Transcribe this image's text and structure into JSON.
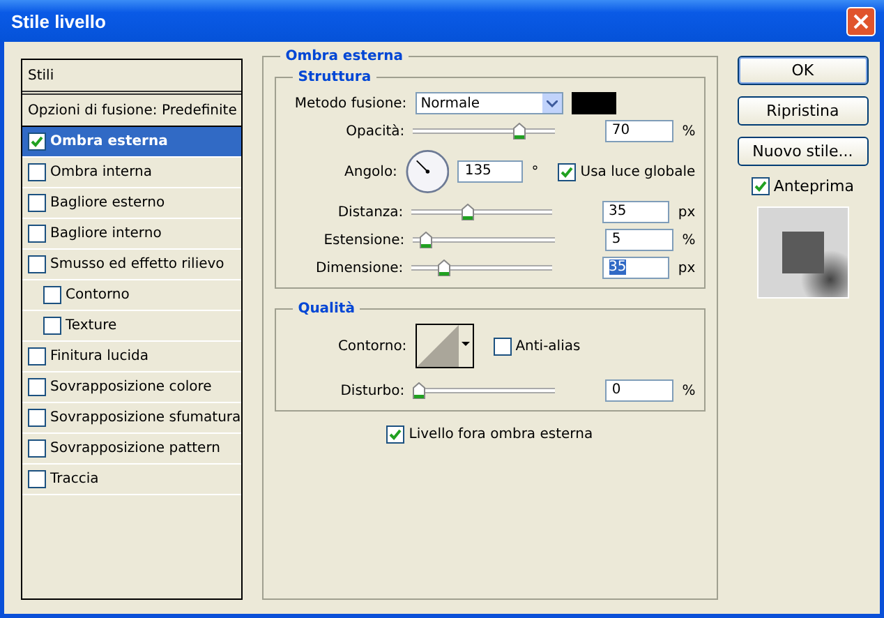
{
  "window": {
    "title": "Stile livello"
  },
  "styles_list": {
    "header": "Stili",
    "blend_options": "Opzioni di fusione: Predefinite",
    "items": [
      {
        "label": "Ombra esterna",
        "checked": true,
        "selected": true
      },
      {
        "label": "Ombra interna",
        "checked": false,
        "selected": false
      },
      {
        "label": "Bagliore esterno",
        "checked": false,
        "selected": false
      },
      {
        "label": "Bagliore interno",
        "checked": false,
        "selected": false
      },
      {
        "label": "Smusso ed effetto rilievo",
        "checked": false,
        "selected": false,
        "children": [
          {
            "label": "Contorno",
            "checked": false,
            "selected": false
          },
          {
            "label": "Texture",
            "checked": false,
            "selected": false
          }
        ]
      },
      {
        "label": "Finitura lucida",
        "checked": false,
        "selected": false
      },
      {
        "label": "Sovrapposizione colore",
        "checked": false,
        "selected": false
      },
      {
        "label": "Sovrapposizione sfumatura",
        "checked": false,
        "selected": false
      },
      {
        "label": "Sovrapposizione pattern",
        "checked": false,
        "selected": false
      },
      {
        "label": "Traccia",
        "checked": false,
        "selected": false
      }
    ]
  },
  "panel": {
    "title": "Ombra esterna",
    "structure": {
      "title": "Struttura",
      "rows": [
        {
          "kind": "dropdown",
          "label": "Metodo fusione:",
          "value": "Normale",
          "color": "#000000"
        },
        {
          "kind": "slider",
          "label": "Opacità:",
          "level": 0.7,
          "value": "70",
          "unit": "%"
        },
        {
          "kind": "angle",
          "label": "Angolo:",
          "value": "135",
          "unit": "°",
          "checkbox": {
            "label": "Usa luce globale",
            "checked": true
          }
        },
        {
          "kind": "slider",
          "label": "Distanza:",
          "level": 0.35,
          "value": "35",
          "unit": "px"
        },
        {
          "kind": "slider",
          "label": "Estensione:",
          "level": 0.05,
          "value": "5",
          "unit": "%"
        },
        {
          "kind": "slider",
          "label": "Dimensione:",
          "level": 0.19,
          "value": "35",
          "unit": "px",
          "selected": true
        }
      ]
    },
    "quality": {
      "title": "Qualità",
      "contour_label": "Contorno:",
      "anti_alias": {
        "label": "Anti-alias",
        "checked": false
      },
      "noise": {
        "label": "Disturbo:",
        "level": 0,
        "value": "0",
        "unit": "%"
      }
    },
    "knockout": {
      "label": "Livello fora ombra esterna",
      "checked": true
    }
  },
  "buttons": [
    {
      "label": "OK",
      "default": true
    },
    {
      "label": "Ripristina",
      "default": false
    },
    {
      "label": "Nuovo stile...",
      "default": false
    }
  ],
  "preview": {
    "label": "Anteprima",
    "checked": true
  }
}
